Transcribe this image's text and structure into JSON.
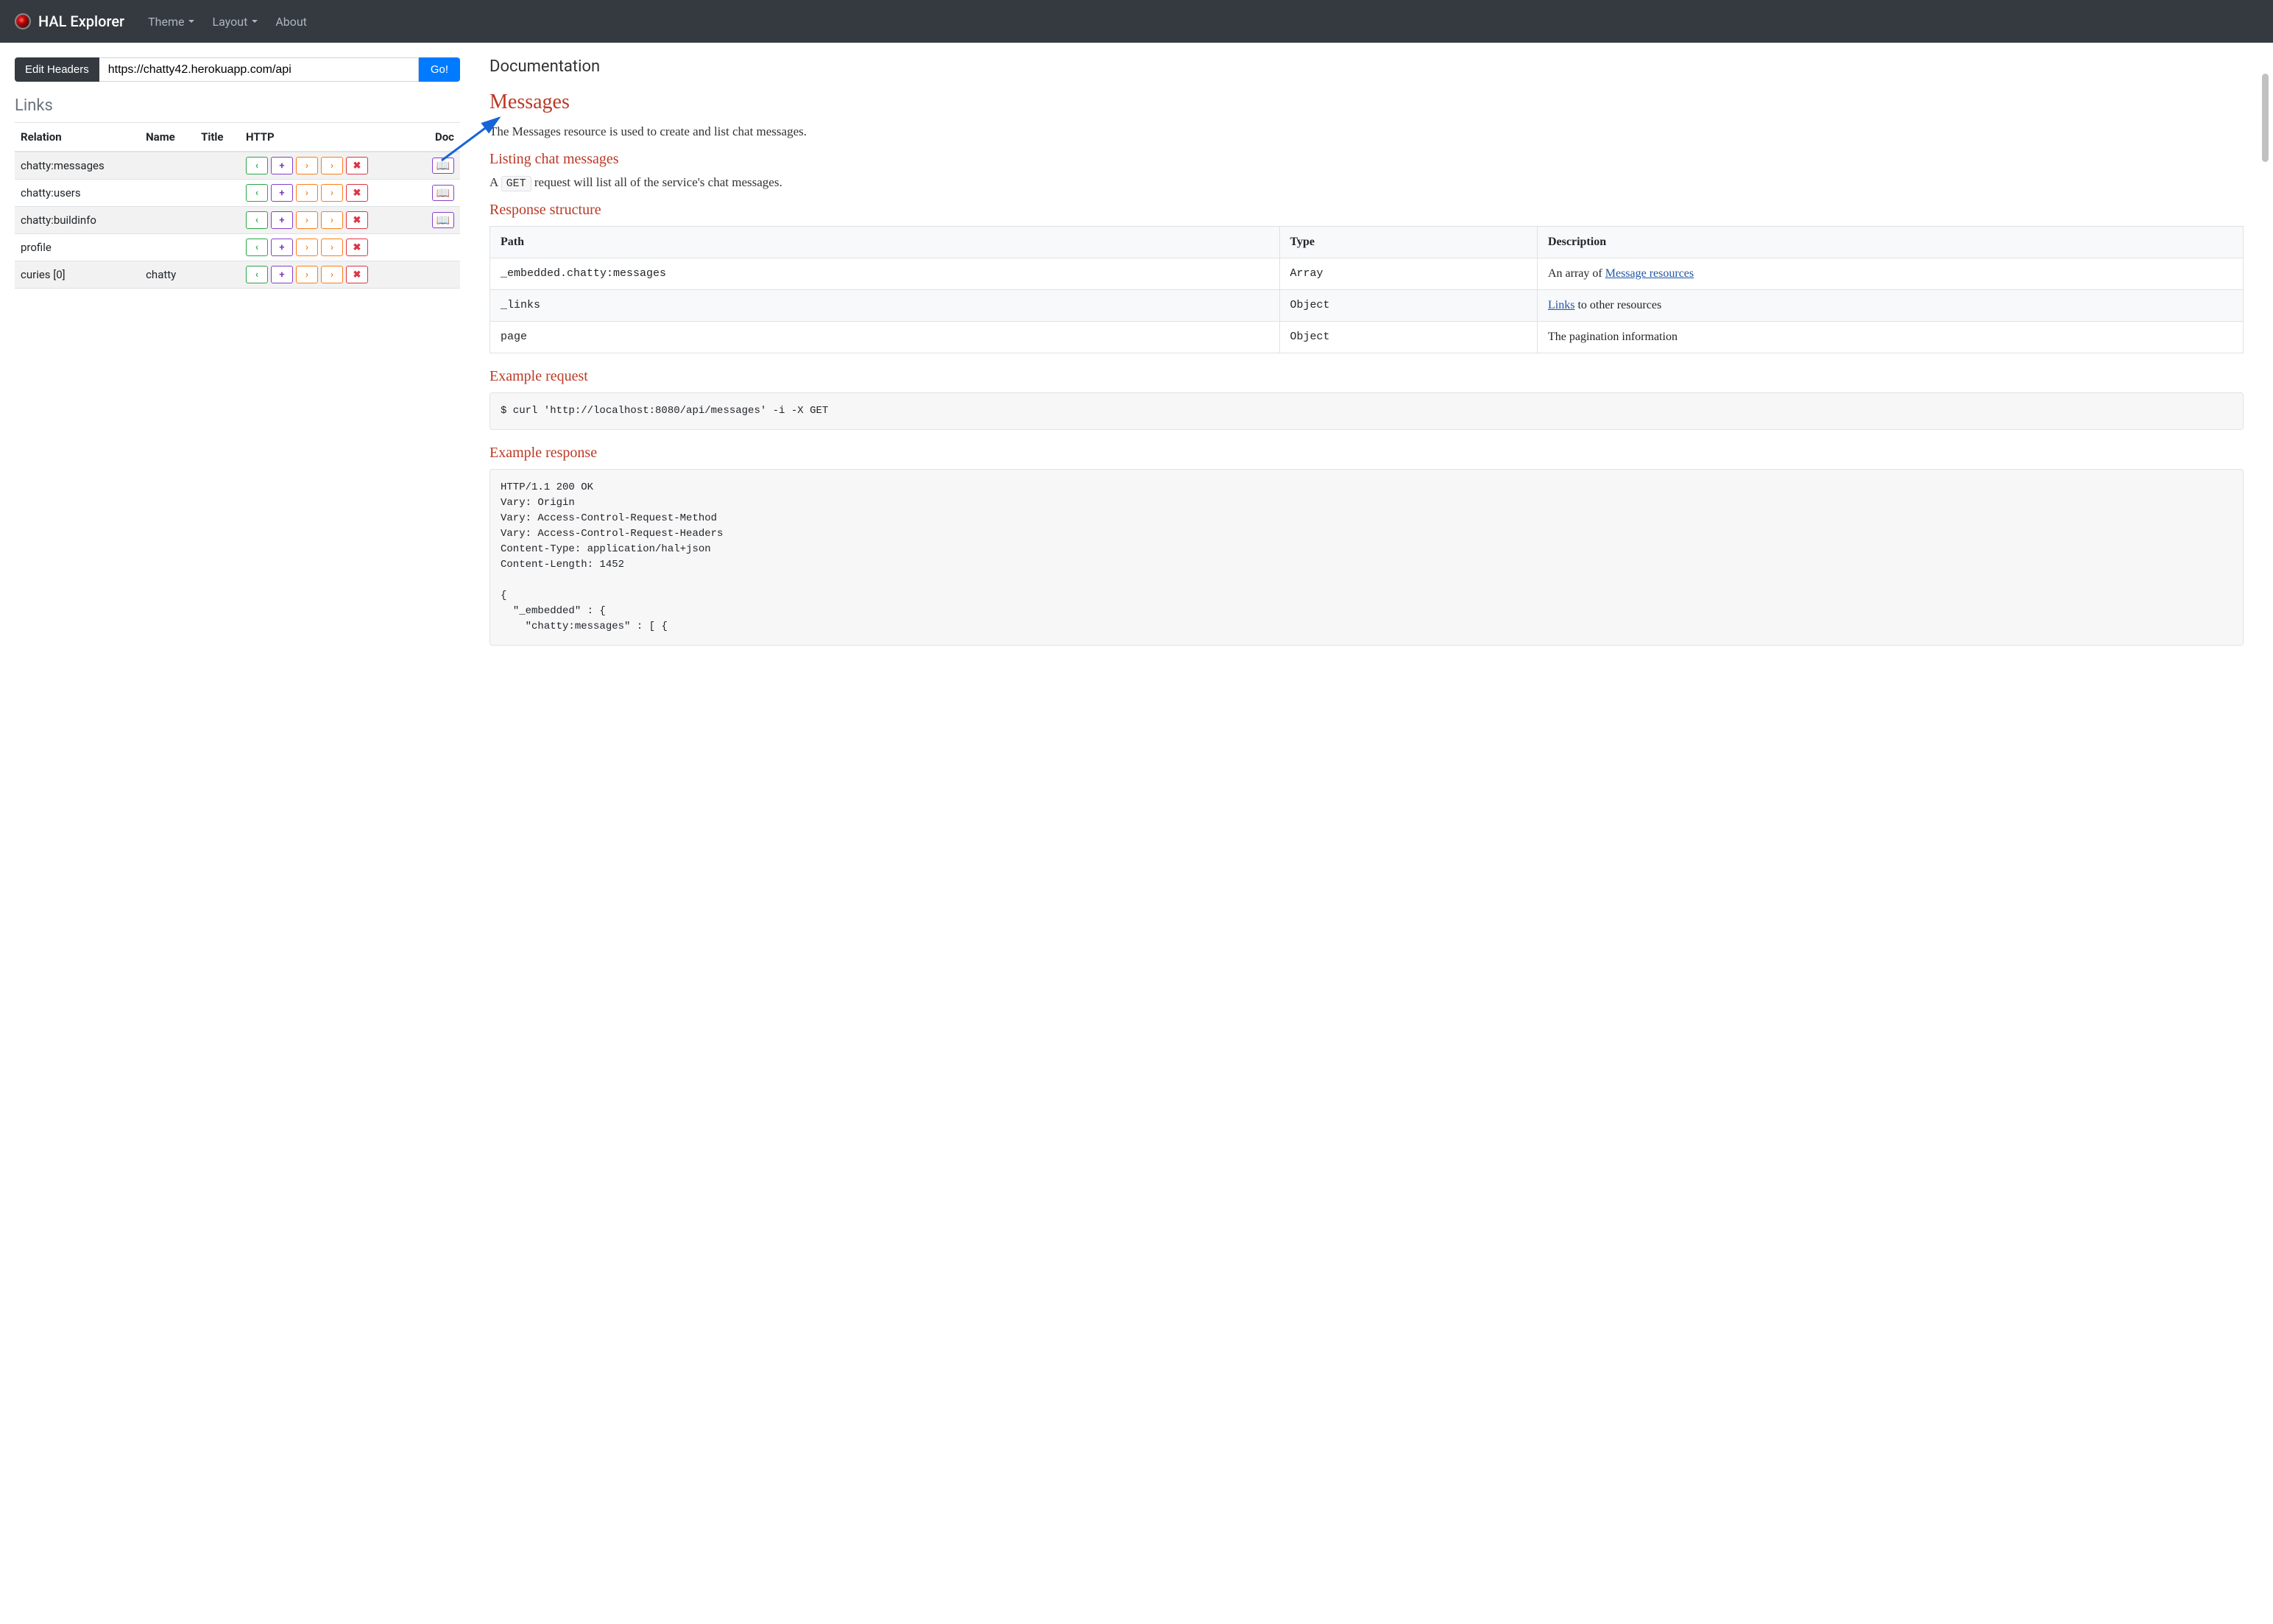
{
  "navbar": {
    "brand": "HAL Explorer",
    "theme": "Theme",
    "layout": "Layout",
    "about": "About"
  },
  "toolbar": {
    "edit_headers": "Edit Headers",
    "url": "https://chatty42.herokuapp.com/api",
    "go": "Go!"
  },
  "links": {
    "title": "Links",
    "headers": {
      "relation": "Relation",
      "name": "Name",
      "title": "Title",
      "http": "HTTP",
      "doc": "Doc"
    },
    "rows": [
      {
        "relation": "chatty:messages",
        "name": "",
        "title": "",
        "doc": true
      },
      {
        "relation": "chatty:users",
        "name": "",
        "title": "",
        "doc": true
      },
      {
        "relation": "chatty:buildinfo",
        "name": "",
        "title": "",
        "doc": true
      },
      {
        "relation": "profile",
        "name": "",
        "title": "",
        "doc": false
      },
      {
        "relation": "curies [0]",
        "name": "chatty",
        "title": "",
        "doc": false
      }
    ]
  },
  "doc": {
    "title": "Documentation",
    "h1": "Messages",
    "intro": "The Messages resource is used to create and list chat messages.",
    "listing_h": "Listing chat messages",
    "listing_p_pre": "A ",
    "listing_p_code": "GET",
    "listing_p_post": " request will list all of the service's chat messages.",
    "resp_h": "Response structure",
    "resp_headers": {
      "path": "Path",
      "type": "Type",
      "desc": "Description"
    },
    "resp_rows": [
      {
        "path": "_embedded.chatty:messages",
        "type": "Array",
        "desc_pre": "An array of ",
        "link": "Message resources",
        "desc_post": ""
      },
      {
        "path": "_links",
        "type": "Object",
        "desc_pre": "",
        "link": "Links",
        "desc_post": " to other resources"
      },
      {
        "path": "page",
        "type": "Object",
        "desc_pre": "The pagination information",
        "link": "",
        "desc_post": ""
      }
    ],
    "ex_req_h": "Example request",
    "ex_req": "$ curl 'http://localhost:8080/api/messages' -i -X GET",
    "ex_resp_h": "Example response",
    "ex_resp": "HTTP/1.1 200 OK\nVary: Origin\nVary: Access-Control-Request-Method\nVary: Access-Control-Request-Headers\nContent-Type: application/hal+json\nContent-Length: 1452\n\n{\n  \"_embedded\" : {\n    \"chatty:messages\" : [ {"
  }
}
